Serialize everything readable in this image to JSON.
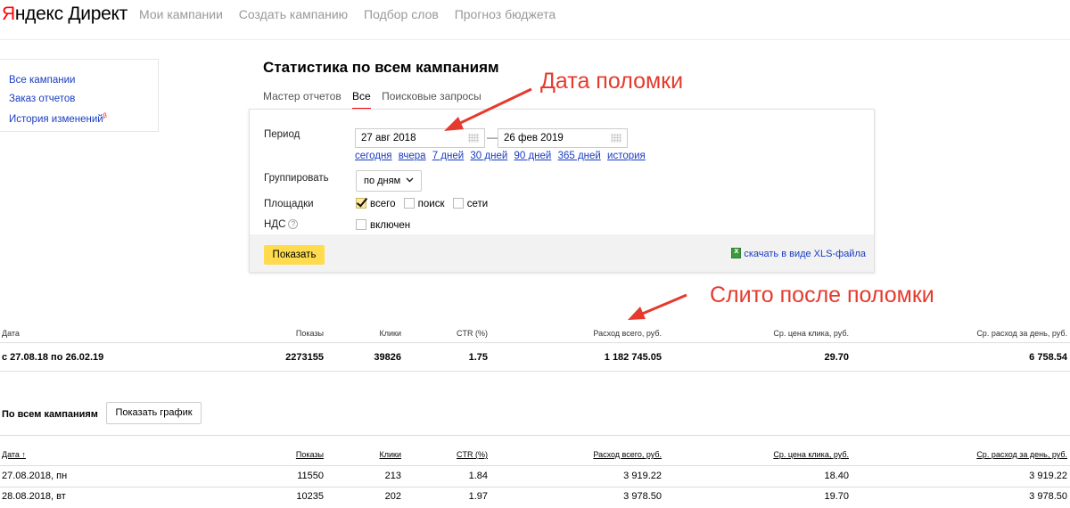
{
  "header": {
    "logo_part1": "Я",
    "logo_part2": "ндекс Директ",
    "nav": [
      "Мои кампании",
      "Создать кампанию",
      "Подбор слов",
      "Прогноз бюджета"
    ]
  },
  "sidebar": {
    "items": [
      {
        "label": "Все кампании"
      },
      {
        "label": "Заказ отчетов"
      },
      {
        "label": "История изменений",
        "badge": "β"
      }
    ]
  },
  "page": {
    "title": "Статистика по всем кампаниям",
    "tabs": [
      "Мастер отчетов",
      "Все",
      "Поисковые запросы"
    ],
    "active_tab": "Все"
  },
  "form": {
    "period_label": "Период",
    "date_from": "27 авг 2018",
    "date_to": "26 фев 2019",
    "dash": "—",
    "quick_links": [
      "сегодня",
      "вчера",
      "7 дней",
      "30 дней",
      "90 дней",
      "365 дней",
      "история"
    ],
    "group_label": "Группировать",
    "group_value": "по дням",
    "platforms_label": "Площадки",
    "platforms": [
      {
        "label": "всего",
        "checked": true
      },
      {
        "label": "поиск",
        "checked": false
      },
      {
        "label": "сети",
        "checked": false
      }
    ],
    "vat_label": "НДС",
    "vat_help": "?",
    "vat_option": "включен",
    "show_button": "Показать",
    "xls_link": "скачать в виде XLS-файла"
  },
  "annotations": {
    "breakdown_date": "Дата поломки",
    "spent_after": "Слито после поломки"
  },
  "summary": {
    "headers": [
      "Дата",
      "Показы",
      "Клики",
      "CTR (%)",
      "Расход всего, руб.",
      "Ср. цена клика, руб.",
      "Ср. расход за день, руб."
    ],
    "row": [
      "с 27.08.18 по 26.02.19",
      "2273155",
      "39826",
      "1.75",
      "1 182 745.05",
      "29.70",
      "6 758.54"
    ]
  },
  "campaigns": {
    "title": "По всем кампаниям",
    "chart_button": "Показать график",
    "headers": [
      "Дата ↑",
      "Показы",
      "Клики",
      "CTR (%)",
      "Расход всего, руб.",
      "Ср. цена клика, руб.",
      "Ср. расход за день, руб."
    ],
    "rows": [
      [
        "27.08.2018, пн",
        "11550",
        "213",
        "1.84",
        "3 919.22",
        "18.40",
        "3 919.22"
      ],
      [
        "28.08.2018, вт",
        "10235",
        "202",
        "1.97",
        "3 978.50",
        "19.70",
        "3 978.50"
      ]
    ]
  }
}
